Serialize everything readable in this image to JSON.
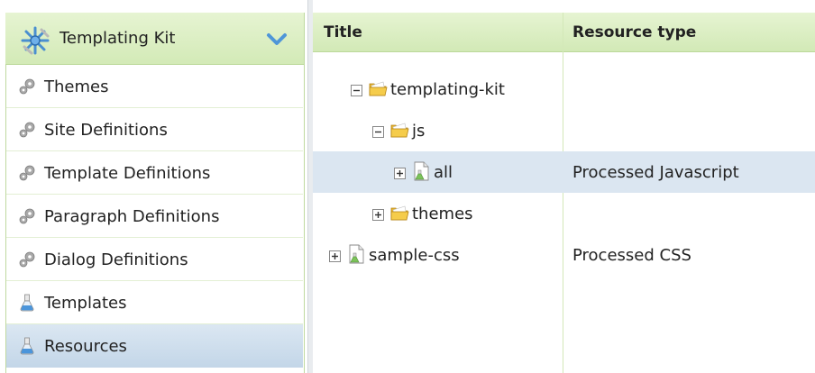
{
  "sidebar": {
    "header": {
      "title": "Templating Kit",
      "icon": "templating-kit-icon",
      "toggle_icon": "chevron-down-icon"
    },
    "items": [
      {
        "label": "Themes",
        "icon": "gear-icon"
      },
      {
        "label": "Site Definitions",
        "icon": "gear-icon"
      },
      {
        "label": "Template Definitions",
        "icon": "gear-icon"
      },
      {
        "label": "Paragraph Definitions",
        "icon": "gear-icon"
      },
      {
        "label": "Dialog Definitions",
        "icon": "gear-icon"
      },
      {
        "label": "Templates",
        "icon": "flask-icon"
      },
      {
        "label": "Resources",
        "icon": "flask-icon",
        "selected": true
      }
    ]
  },
  "grid": {
    "columns": {
      "title": "Title",
      "resource_type": "Resource type"
    },
    "rows": [
      {
        "name": "templating-kit",
        "type": "",
        "icon": "folder-icon",
        "expander": "collapse",
        "depth": 1
      },
      {
        "name": "js",
        "type": "",
        "icon": "folder-icon",
        "expander": "collapse",
        "depth": 2
      },
      {
        "name": "all",
        "type": "Processed Javascript",
        "icon": "document-icon",
        "expander": "expand",
        "depth": 3,
        "selected": true
      },
      {
        "name": "themes",
        "type": "",
        "icon": "folder-icon",
        "expander": "expand",
        "depth": 2
      },
      {
        "name": "sample-css",
        "type": "Processed CSS",
        "icon": "document-icon",
        "expander": "expand",
        "depth": 0
      }
    ]
  },
  "colors": {
    "header_green": "#d3eab7",
    "selection_blue": "#dbe6f1",
    "border_green": "#bcd89a"
  }
}
